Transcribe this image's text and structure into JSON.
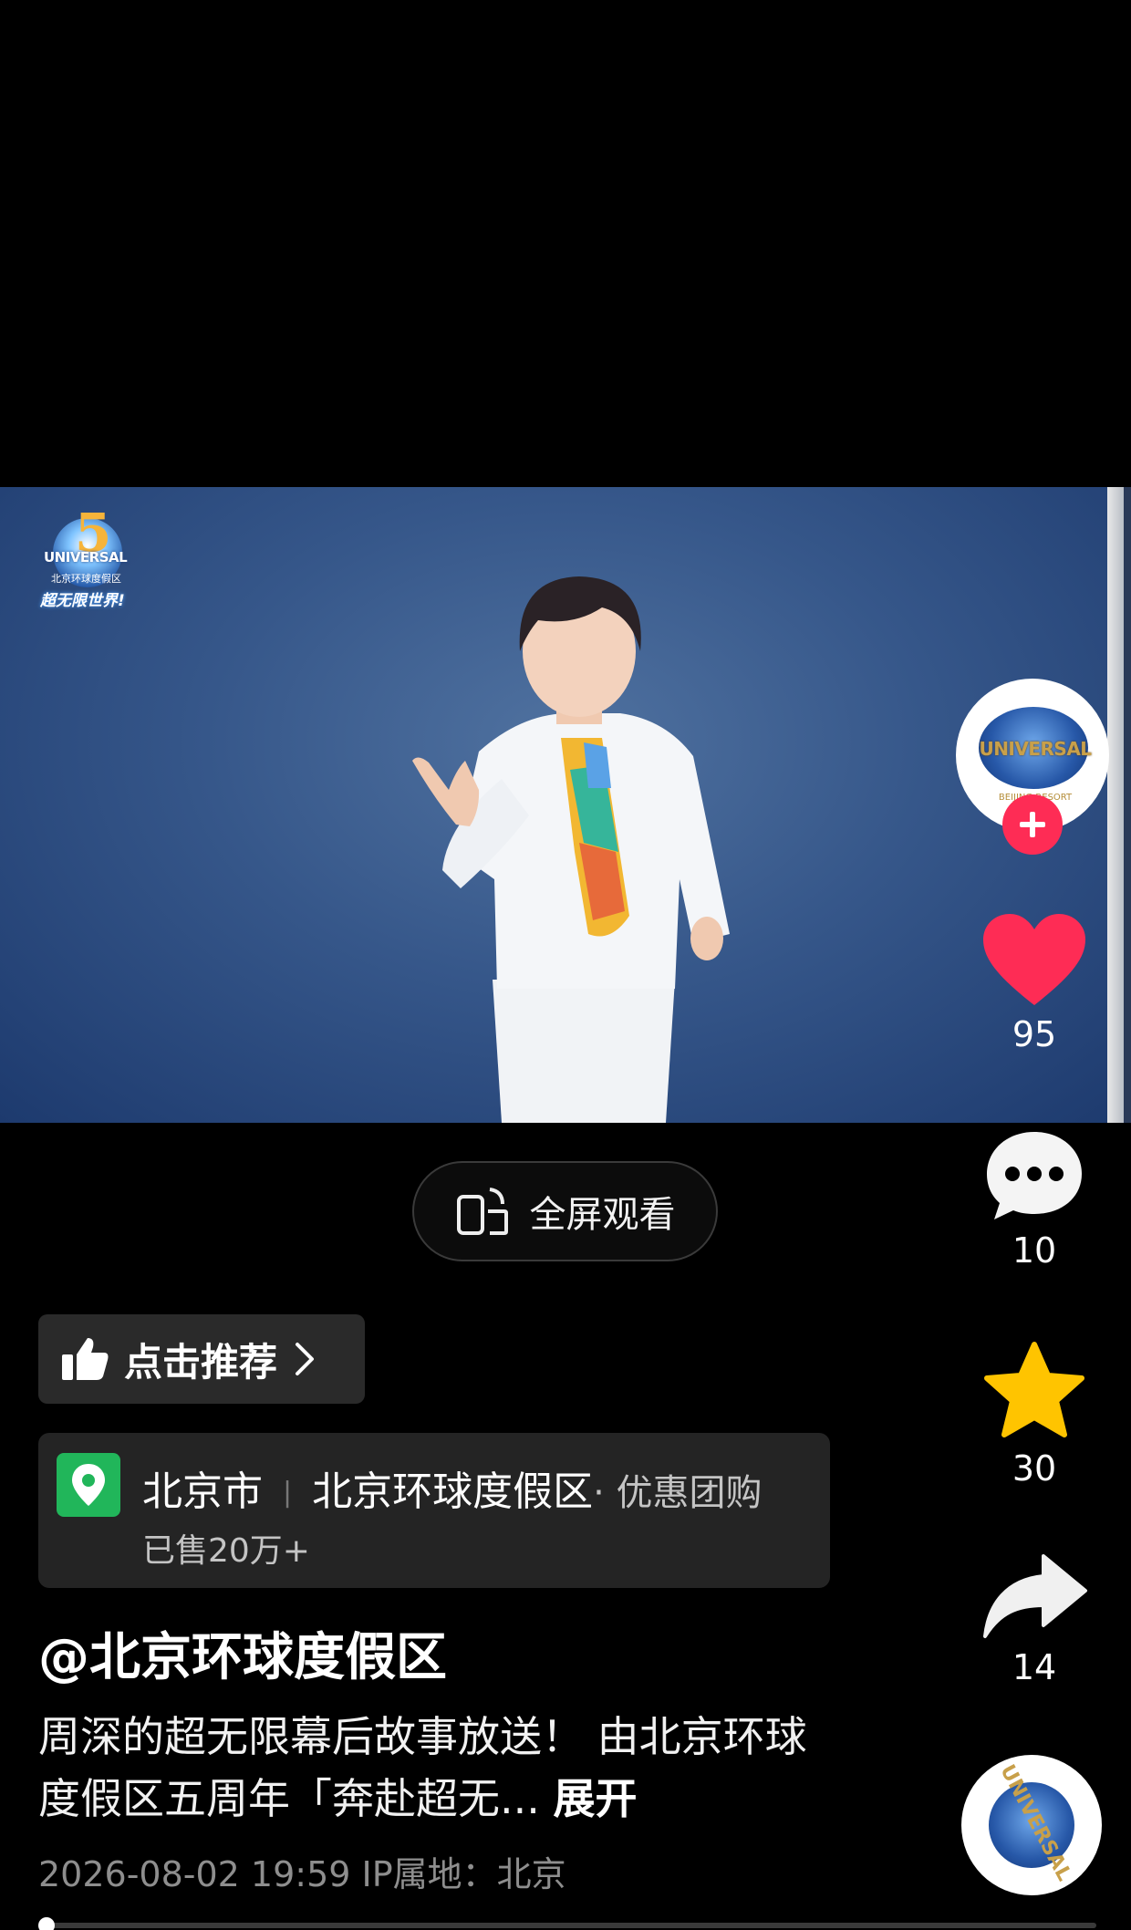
{
  "video": {
    "logo_slogan": "超无限世界!",
    "logo_text": "UNIVERSAL",
    "logo_subtext": "北京环球度假区"
  },
  "actions": {
    "avatar_text": "UNIVERSAL",
    "avatar_subtext": "BEIJING RESORT",
    "like_count": "95",
    "comment_count": "10",
    "favorite_count": "30",
    "share_count": "14",
    "music_disc_text": "UNIVERSAL"
  },
  "fullscreen": {
    "label": "全屏观看"
  },
  "recommend": {
    "label": "点击推荐"
  },
  "poi": {
    "city": "北京市",
    "name": "北京环球度假区",
    "tag": "· 优惠团购",
    "sold": "已售20万+"
  },
  "post": {
    "author": "@北京环球度假区",
    "description": "周深的超无限幕后故事放送！ 由北京环球度假区五周年「奔赴超无...",
    "expand_label": "展开",
    "meta": "2026-08-02 19:59   IP属地：北京"
  },
  "progress": {
    "value": 0.0
  },
  "colors": {
    "like": "#fe2c55",
    "favorite": "#ffc400",
    "poi_pin": "#21b65a"
  }
}
